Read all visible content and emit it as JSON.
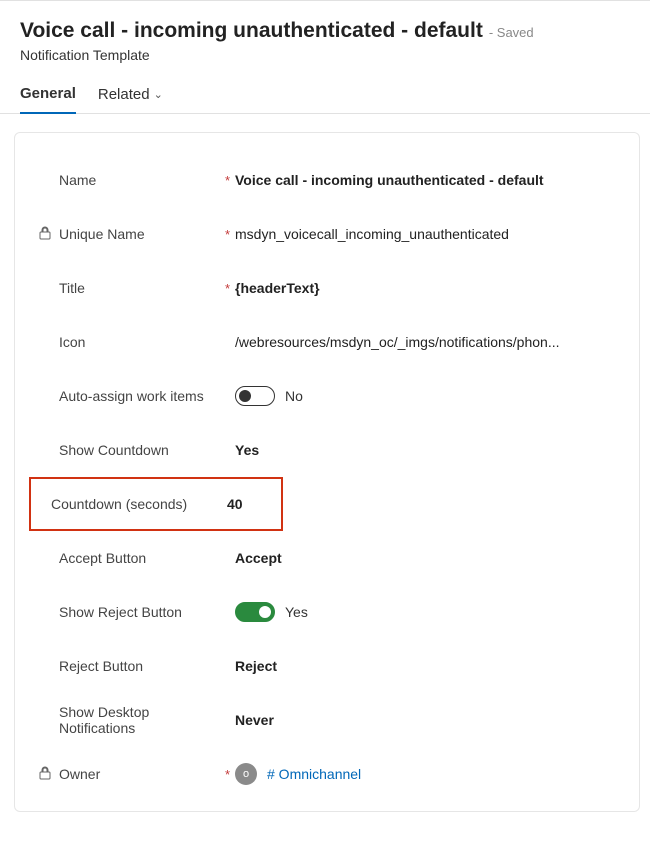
{
  "header": {
    "title": "Voice call - incoming unauthenticated - default",
    "saved": "- Saved",
    "subtitle": "Notification Template"
  },
  "tabs": {
    "general": "General",
    "related": "Related"
  },
  "form": {
    "name": {
      "label": "Name",
      "value": "Voice call - incoming unauthenticated - default"
    },
    "uniqueName": {
      "label": "Unique Name",
      "value": "msdyn_voicecall_incoming_unauthenticated"
    },
    "title": {
      "label": "Title",
      "value": "{headerText}"
    },
    "icon": {
      "label": "Icon",
      "value": "/webresources/msdyn_oc/_imgs/notifications/phon..."
    },
    "autoAssign": {
      "label": "Auto-assign work items",
      "value": "No"
    },
    "showCountdown": {
      "label": "Show Countdown",
      "value": "Yes"
    },
    "countdown": {
      "label": "Countdown (seconds)",
      "value": "40"
    },
    "acceptButton": {
      "label": "Accept Button",
      "value": "Accept"
    },
    "showReject": {
      "label": "Show Reject Button",
      "value": "Yes"
    },
    "rejectButton": {
      "label": "Reject Button",
      "value": "Reject"
    },
    "desktopNotif": {
      "label": "Show Desktop Notifications",
      "value": "Never"
    },
    "owner": {
      "label": "Owner",
      "initial": "o",
      "value": "# Omnichannel"
    }
  },
  "requiredMark": "*"
}
